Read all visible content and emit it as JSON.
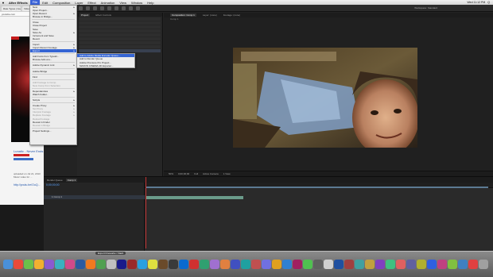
{
  "menubar": {
    "apple": "",
    "app": "After Effects",
    "items": [
      "File",
      "Edit",
      "Composition",
      "Layer",
      "Effect",
      "Animation",
      "View",
      "Window",
      "Help"
    ],
    "active_index": 0,
    "status": [
      "Wed 11:12 PM",
      "Q"
    ]
  },
  "browser": {
    "tabs": [
      "Rate Types | Google ...",
      "Video"
    ],
    "url": "youtube.com",
    "video_title": "Lunatic - Never Ends",
    "video_text": "uploaded on Jul 21, 2013 Music video for ...",
    "video_link": "http://youtu.be/OuQ..."
  },
  "toolbar": {
    "workspace": "Workspace: Standard"
  },
  "project_panel": {
    "tabs": [
      "Project",
      "Effect Controls"
    ]
  },
  "comp_panel": {
    "tabs": [
      "Composition: Comp 1",
      "Layer: (none)",
      "Footage: (none)"
    ],
    "sub": "Comp 1",
    "footer": [
      "50%",
      "0;00;00;00",
      "Full",
      "Active Camera",
      "1 View"
    ]
  },
  "timeline": {
    "tabs": [
      "Render Queue",
      "Comp 1"
    ],
    "time": "0;00;00;00",
    "layer_name": "1  Comp 1"
  },
  "file_menu": {
    "items": [
      {
        "label": "New",
        "sc": "▸",
        "disabled": false
      },
      {
        "label": "Open Project...",
        "sc": "",
        "disabled": false
      },
      {
        "label": "Open Recent",
        "sc": "▸",
        "disabled": false
      },
      {
        "label": "Browse in Bridge...",
        "sc": "",
        "disabled": false
      },
      {
        "sep": true
      },
      {
        "label": "Close",
        "sc": "",
        "disabled": false
      },
      {
        "label": "Close Project",
        "sc": "",
        "disabled": false
      },
      {
        "label": "Save",
        "sc": "",
        "disabled": false
      },
      {
        "label": "Save As",
        "sc": "▸",
        "disabled": false
      },
      {
        "label": "Increment and Save",
        "sc": "",
        "disabled": false
      },
      {
        "label": "Revert",
        "sc": "",
        "disabled": false
      },
      {
        "sep": true
      },
      {
        "label": "Import",
        "sc": "▸",
        "disabled": false
      },
      {
        "label": "Import Recent Footage",
        "sc": "▸",
        "disabled": false
      },
      {
        "label": "Export",
        "sc": "▸",
        "disabled": false,
        "active": true
      },
      {
        "sep": true
      },
      {
        "label": "Add Fonts from Typekit...",
        "sc": "",
        "disabled": false
      },
      {
        "label": "Browse Add-ons...",
        "sc": "",
        "disabled": false
      },
      {
        "sep": true
      },
      {
        "label": "Adobe Dynamic Link",
        "sc": "▸",
        "disabled": false
      },
      {
        "sep": true
      },
      {
        "label": "Adobe Bridge",
        "sc": "",
        "disabled": false
      },
      {
        "sep": true
      },
      {
        "label": "Find",
        "sc": "",
        "disabled": false
      },
      {
        "sep": true
      },
      {
        "label": "Add Footage to Comp",
        "sc": "",
        "disabled": true
      },
      {
        "label": "New Comp from Selection",
        "sc": "",
        "disabled": true
      },
      {
        "sep": true
      },
      {
        "label": "Dependencies",
        "sc": "▸",
        "disabled": false
      },
      {
        "label": "Watch Folder...",
        "sc": "",
        "disabled": false
      },
      {
        "sep": true
      },
      {
        "label": "Scripts",
        "sc": "▸",
        "disabled": false
      },
      {
        "sep": true
      },
      {
        "label": "Create Proxy",
        "sc": "▸",
        "disabled": false
      },
      {
        "label": "Set Proxy",
        "sc": "▸",
        "disabled": true
      },
      {
        "label": "Interpret Footage",
        "sc": "▸",
        "disabled": true
      },
      {
        "label": "Replace Footage",
        "sc": "▸",
        "disabled": true
      },
      {
        "label": "Reload Footage",
        "sc": "",
        "disabled": true
      },
      {
        "label": "Reveal in Finder",
        "sc": "",
        "disabled": false
      },
      {
        "label": "Reveal in Bridge",
        "sc": "",
        "disabled": true
      },
      {
        "sep": true
      },
      {
        "label": "Project Settings...",
        "sc": "",
        "disabled": false
      }
    ]
  },
  "export_submenu": {
    "items": [
      {
        "label": "Add to Adobe Media Encoder Queue...",
        "active": true
      },
      {
        "label": "Add to Render Queue",
        "active": false
      },
      {
        "label": "Adobe Premiere Pro Project...",
        "active": false
      },
      {
        "label": "MAXON CINEMA 4D Exporter...",
        "active": false
      }
    ]
  },
  "dock": {
    "label": "Export Fireworks / Flash"
  },
  "colors": {
    "accent": "#3565d4",
    "panel": "#232323",
    "playhead": "#c23030"
  }
}
